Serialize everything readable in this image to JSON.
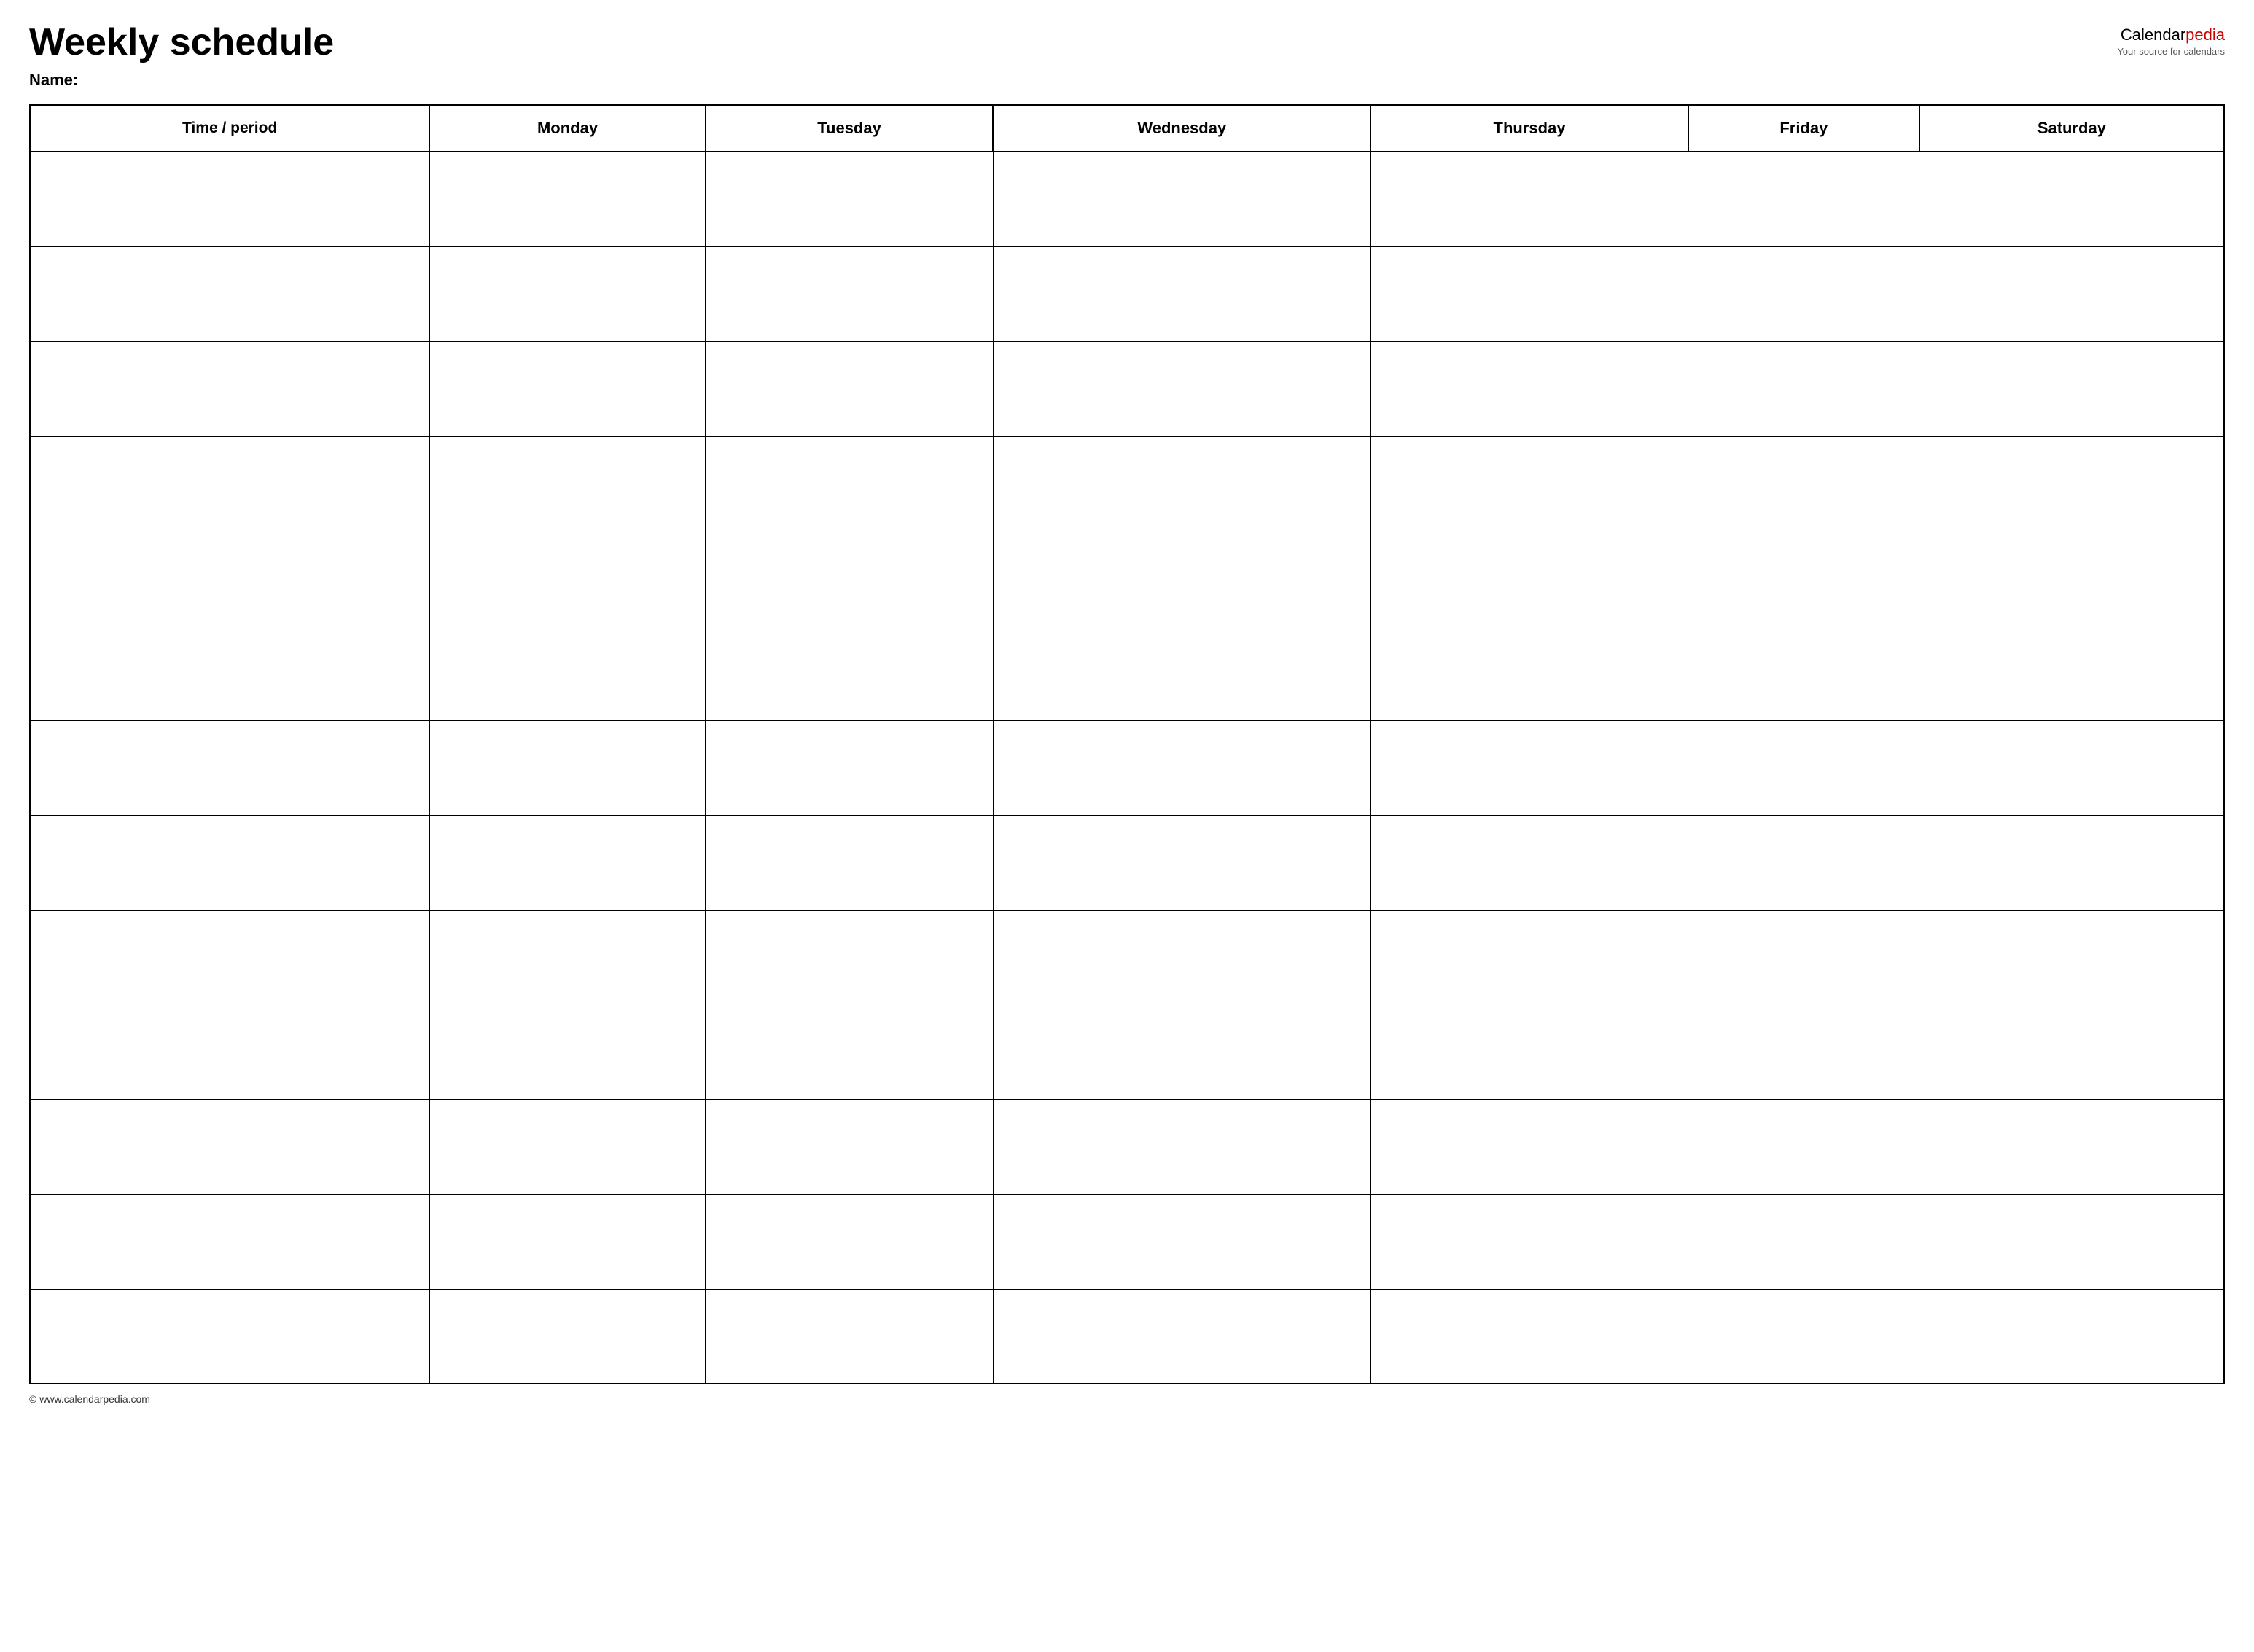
{
  "header": {
    "title": "Weekly schedule",
    "logo": {
      "calendar": "Calendar",
      "pedia": "pedia",
      "tagline": "Your source for calendars"
    },
    "name_label": "Name:"
  },
  "table": {
    "columns": [
      {
        "id": "time",
        "label": "Time / period"
      },
      {
        "id": "monday",
        "label": "Monday"
      },
      {
        "id": "tuesday",
        "label": "Tuesday"
      },
      {
        "id": "wednesday",
        "label": "Wednesday"
      },
      {
        "id": "thursday",
        "label": "Thursday"
      },
      {
        "id": "friday",
        "label": "Friday"
      },
      {
        "id": "saturday",
        "label": "Saturday"
      }
    ],
    "row_count": 13
  },
  "footer": {
    "text": "© www.calendarpedia.com"
  }
}
